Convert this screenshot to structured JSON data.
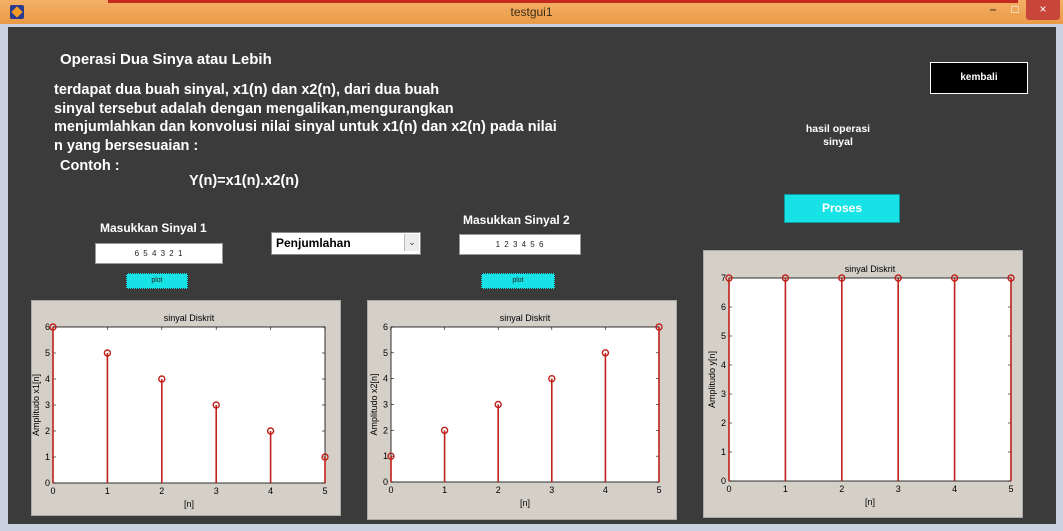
{
  "window": {
    "title": "testgui1",
    "close_glyph": "×",
    "minimize_glyph": "–",
    "maximize_glyph": "□"
  },
  "heading": "Operasi Dua Sinya atau Lebih",
  "description": [
    "terdapat dua buah sinyal, x1(n) dan x2(n), dari dua buah",
    "sinyal tersebut adalah dengan mengalikan,mengurangkan",
    "menjumlahkan dan konvolusi nilai sinyal untuk x1(n) dan x2(n) pada nilai",
    "n yang bersesuaian   :"
  ],
  "contoh_label": "Contoh :",
  "formula": "Y(n)=x1(n).x2(n)",
  "input1": {
    "label": "Masukkan Sinyal 1",
    "value": "6 5 4 3 2 1",
    "plot_label": "plot"
  },
  "input2": {
    "label": "Masukkan Sinyal 2",
    "value": "1 2 3 4 5 6",
    "plot_label": "plot"
  },
  "operation": {
    "selected": "Penjumlahan",
    "arrow_glyph": "⌄"
  },
  "buttons": {
    "kembali": "kembali",
    "proses": "Proses"
  },
  "result_label": [
    "hasil operasi",
    "sinyal"
  ],
  "chart_data": [
    {
      "type": "stem",
      "title": "sinyal Diskrit",
      "xlabel": "[n]",
      "ylabel": "Amplitudo x1[n]",
      "x": [
        0,
        1,
        2,
        3,
        4,
        5
      ],
      "values": [
        6,
        5,
        4,
        3,
        2,
        1
      ],
      "xlim": [
        0,
        5
      ],
      "ylim": [
        0,
        6
      ],
      "xticks": [
        0,
        1,
        2,
        3,
        4,
        5
      ],
      "yticks": [
        0,
        1,
        2,
        3,
        4,
        5,
        6
      ],
      "color": "#c0201a"
    },
    {
      "type": "stem",
      "title": "sinyal Diskrit",
      "xlabel": "[n]",
      "ylabel": "Amplitudo x2[n]",
      "x": [
        0,
        1,
        2,
        3,
        4,
        5
      ],
      "values": [
        1,
        2,
        3,
        4,
        5,
        6
      ],
      "xlim": [
        0,
        5
      ],
      "ylim": [
        0,
        6
      ],
      "xticks": [
        0,
        1,
        2,
        3,
        4,
        5
      ],
      "yticks": [
        0,
        1,
        2,
        3,
        4,
        5,
        6
      ],
      "color": "#c0201a"
    },
    {
      "type": "stem",
      "title": "sinyal Diskrit",
      "xlabel": "[n]",
      "ylabel": "Amplitudo y[n]",
      "x": [
        0,
        1,
        2,
        3,
        4,
        5
      ],
      "values": [
        7,
        7,
        7,
        7,
        7,
        7
      ],
      "xlim": [
        0,
        5
      ],
      "ylim": [
        0,
        7
      ],
      "xticks": [
        0,
        1,
        2,
        3,
        4,
        5
      ],
      "yticks": [
        0,
        1,
        2,
        3,
        4,
        5,
        6,
        7
      ],
      "color": "#c0201a"
    }
  ]
}
